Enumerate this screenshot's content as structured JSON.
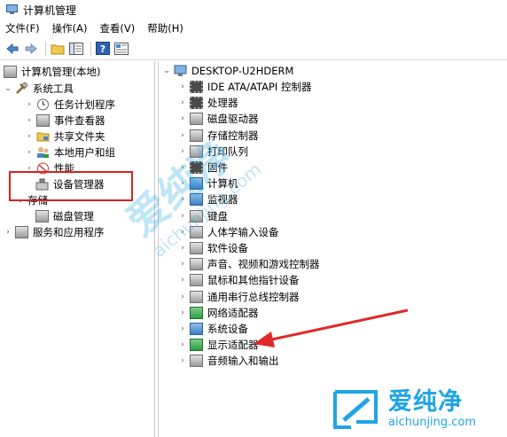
{
  "window": {
    "title": "计算机管理"
  },
  "menu": [
    {
      "label": "文件(F)"
    },
    {
      "label": "操作(A)"
    },
    {
      "label": "查看(V)"
    },
    {
      "label": "帮助(H)"
    }
  ],
  "left_tree": {
    "root": "计算机管理(本地)",
    "system_tools": "系统工具",
    "task_scheduler": "任务计划程序",
    "event_viewer": "事件查看器",
    "shared_folders": "共享文件夹",
    "local_users": "本地用户和组",
    "performance": "性能",
    "device_manager": "设备管理器",
    "storage": "存储",
    "disk_management": "磁盘管理",
    "services_apps": "服务和应用程序"
  },
  "device_tree": {
    "computer_name": "DESKTOP-U2HDERM",
    "categories": [
      {
        "label": "IDE ATA/ATAPI 控制器",
        "icon": "chip"
      },
      {
        "label": "处理器",
        "icon": "chip"
      },
      {
        "label": "磁盘驱动器",
        "icon": "gray"
      },
      {
        "label": "存储控制器",
        "icon": "gray"
      },
      {
        "label": "打印队列",
        "icon": "gray"
      },
      {
        "label": "固件",
        "icon": "chip"
      },
      {
        "label": "计算机",
        "icon": "dev"
      },
      {
        "label": "监视器",
        "icon": "dev"
      },
      {
        "label": "键盘",
        "icon": "gray"
      },
      {
        "label": "人体学输入设备",
        "icon": "gray"
      },
      {
        "label": "软件设备",
        "icon": "gray"
      },
      {
        "label": "声音、视频和游戏控制器",
        "icon": "gray"
      },
      {
        "label": "鼠标和其他指针设备",
        "icon": "gray"
      },
      {
        "label": "通用串行总线控制器",
        "icon": "gray"
      },
      {
        "label": "网络适配器",
        "icon": "green"
      },
      {
        "label": "系统设备",
        "icon": "dev"
      },
      {
        "label": "显示适配器",
        "icon": "green"
      },
      {
        "label": "音频输入和输出",
        "icon": "gray"
      }
    ]
  },
  "watermark": {
    "big_cn": "爱纯净",
    "big_en": "aichunjing.com",
    "badge_cn": "爱纯净",
    "badge_en": "aichunjing.com"
  },
  "colors": {
    "highlight": "#d8231f",
    "arrow": "#e0282a",
    "watermark": "#1ea5e6"
  }
}
